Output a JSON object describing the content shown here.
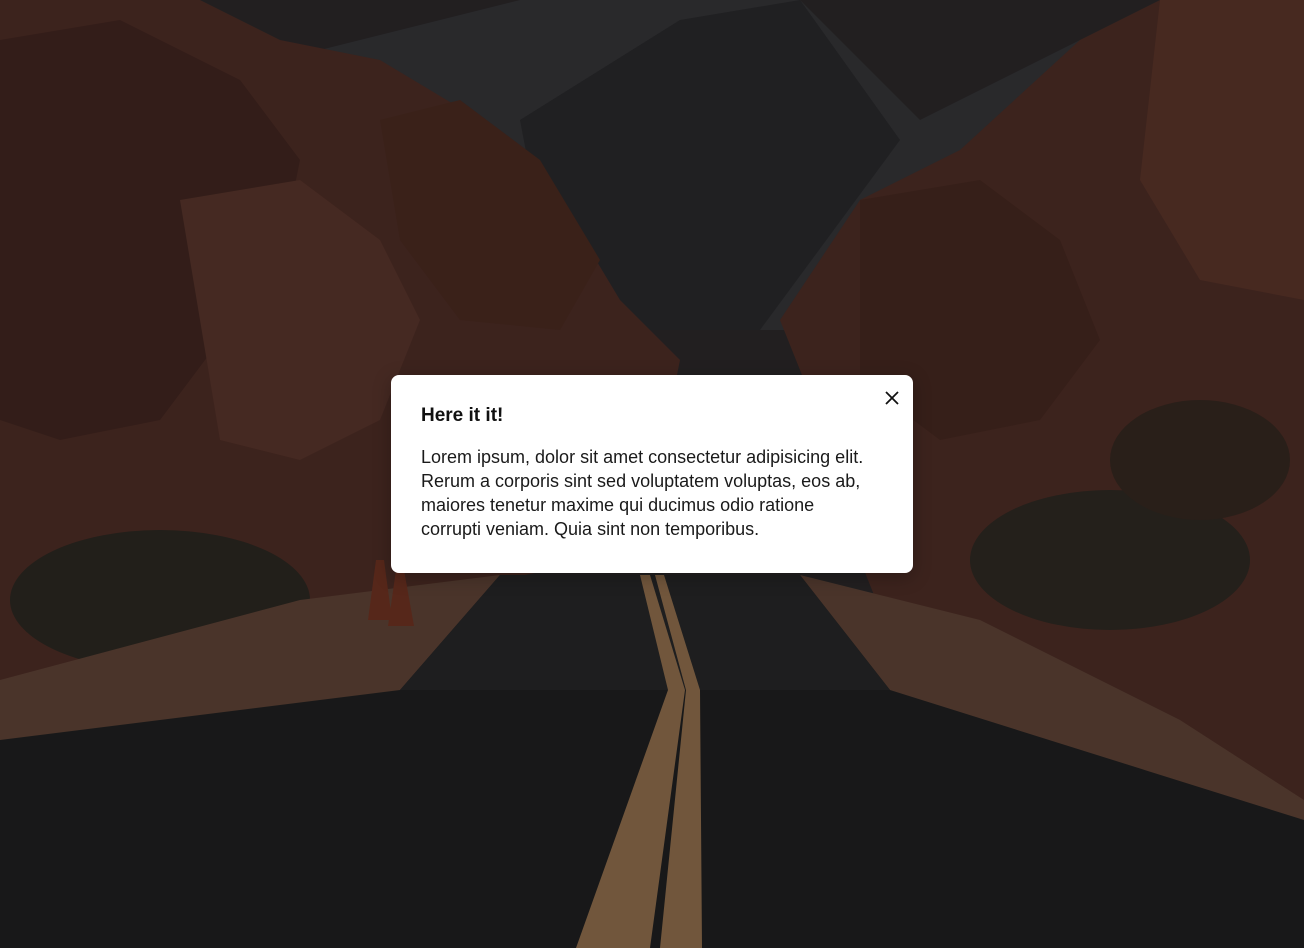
{
  "background": {
    "scene": "desert-road-canyon-photo"
  },
  "modal": {
    "title": "Here it it!",
    "body": "Lorem ipsum, dolor sit amet consectetur adipisicing elit. Rerum a corporis sint sed voluptatem voluptas, eos ab, maiores tenetur maxime qui ducimus odio ratione corrupti veniam. Quia sint non temporibus.",
    "close_icon": "close-icon"
  },
  "colors": {
    "modal_background": "#ffffff",
    "text": "#111111"
  }
}
